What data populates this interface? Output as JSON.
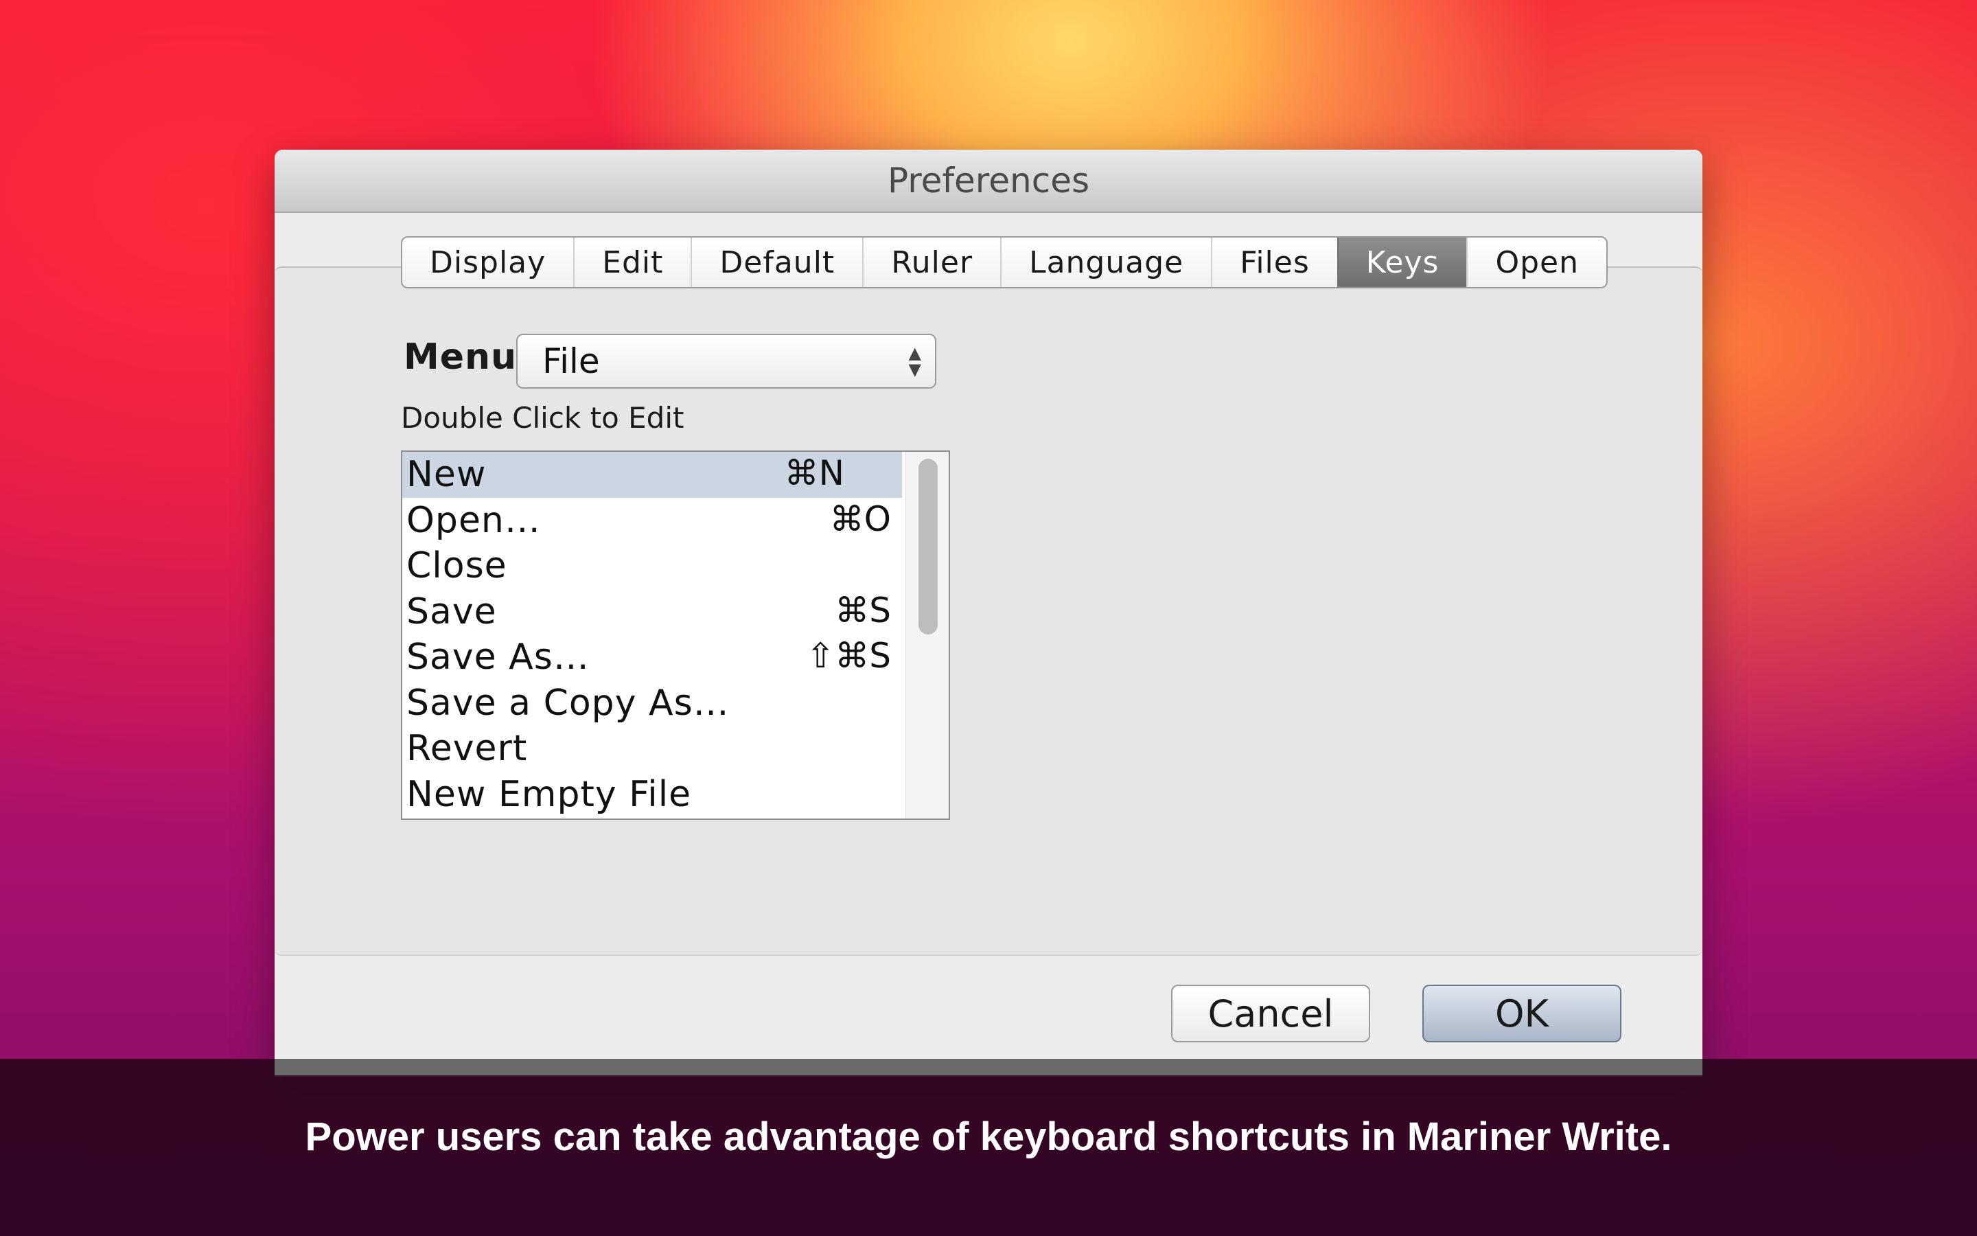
{
  "window": {
    "title": "Preferences"
  },
  "tabs": [
    {
      "label": "Display"
    },
    {
      "label": "Edit"
    },
    {
      "label": "Default"
    },
    {
      "label": "Ruler"
    },
    {
      "label": "Language"
    },
    {
      "label": "Files"
    },
    {
      "label": "Keys"
    },
    {
      "label": "Open"
    }
  ],
  "active_tab": "Keys",
  "menu": {
    "label": "Menu:",
    "selected": "File"
  },
  "hint": "Double Click to Edit",
  "items": [
    {
      "label": "New",
      "shortcut": "⌘N"
    },
    {
      "label": "Open…",
      "shortcut": "⌘O"
    },
    {
      "label": "Close",
      "shortcut": ""
    },
    {
      "label": "Save",
      "shortcut": "⌘S"
    },
    {
      "label": "Save As…",
      "shortcut": "⇧⌘S"
    },
    {
      "label": "Save a Copy As…",
      "shortcut": ""
    },
    {
      "label": "Revert",
      "shortcut": ""
    },
    {
      "label": "New Empty File",
      "shortcut": ""
    }
  ],
  "buttons": {
    "cancel": "Cancel",
    "ok": "OK"
  },
  "caption": "Power users can take advantage of keyboard shortcuts in Mariner Write."
}
